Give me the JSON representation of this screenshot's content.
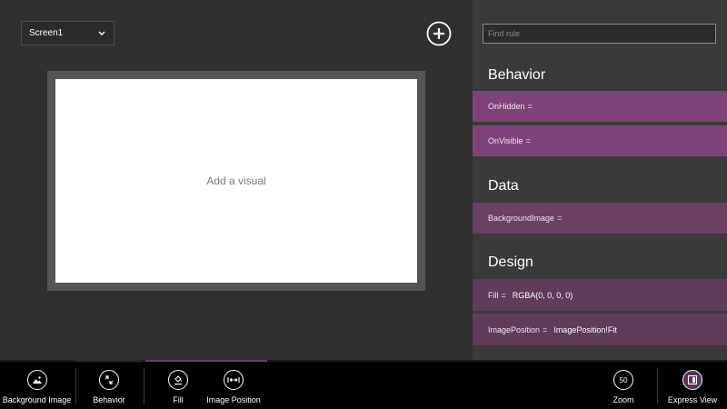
{
  "canvas": {
    "screen_selector": {
      "value": "Screen1",
      "icon": "chevron-down-icon"
    },
    "add_button": {
      "icon": "plus-circle-icon"
    },
    "placeholder_text": "Add a visual"
  },
  "rules": {
    "search": {
      "placeholder": "Find rule",
      "value": ""
    },
    "sections": [
      {
        "title": "Behavior",
        "rules": [
          {
            "name": "OnHidden",
            "op": "=",
            "value": ""
          },
          {
            "name": "OnVisible",
            "op": "=",
            "value": ""
          }
        ]
      },
      {
        "title": "Data",
        "rules": [
          {
            "name": "BackgroundImage",
            "op": "=",
            "value": ""
          }
        ]
      },
      {
        "title": "Design",
        "rules": [
          {
            "name": "Fill",
            "op": "=",
            "value": "RGBA(0, 0, 0, 0)"
          },
          {
            "name": "ImagePosition",
            "op": "=",
            "value": "ImagePosition!Fit"
          }
        ]
      }
    ]
  },
  "appbar": {
    "buttons": [
      {
        "label": "Background Image",
        "icon": "image-icon"
      },
      {
        "label": "Behavior",
        "icon": "behavior-icon"
      },
      {
        "label": "Fill",
        "icon": "paint-bucket-icon"
      },
      {
        "label": "Image Position",
        "icon": "image-position-icon"
      },
      {
        "label": "Zoom",
        "value": "50"
      },
      {
        "label": "Express View",
        "icon": "express-view-icon"
      }
    ]
  },
  "colors": {
    "accent": "#7e4479",
    "accent_dark": "#5e3c5a",
    "background": "#2e2e2e",
    "panel": "#3a3a3a"
  }
}
